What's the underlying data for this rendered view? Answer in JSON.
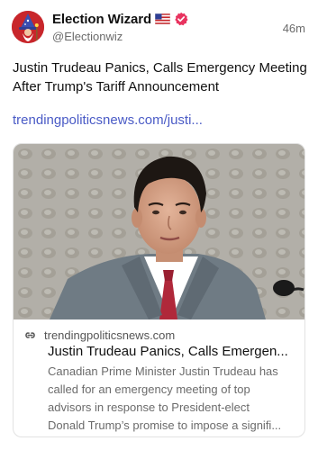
{
  "author": {
    "display_name": "Election Wizard",
    "handle": "@Electionwiz",
    "flag_icon": "us-flag-icon",
    "badge_icon": "verified-badge-icon",
    "badge_color": "#e8335f"
  },
  "post": {
    "timestamp": "46m",
    "text": "Justin Trudeau Panics, Calls Emergency Meeting After Trump's Tariff Announcement",
    "link_text": "trendingpoliticsnews.com/justi...",
    "link_color": "#4a5bc6"
  },
  "card": {
    "image": "photo-of-justin-trudeau",
    "link_icon": "link-icon",
    "domain": "trendingpoliticsnews.com",
    "title": "Justin Trudeau Panics, Calls Emergen...",
    "description_lines": [
      "Canadian Prime Minister Justin Trudeau has",
      "called for an emergency meeting of top",
      "advisors in response to President-elect",
      "Donald Trump’s promise to impose a signifi..."
    ]
  }
}
